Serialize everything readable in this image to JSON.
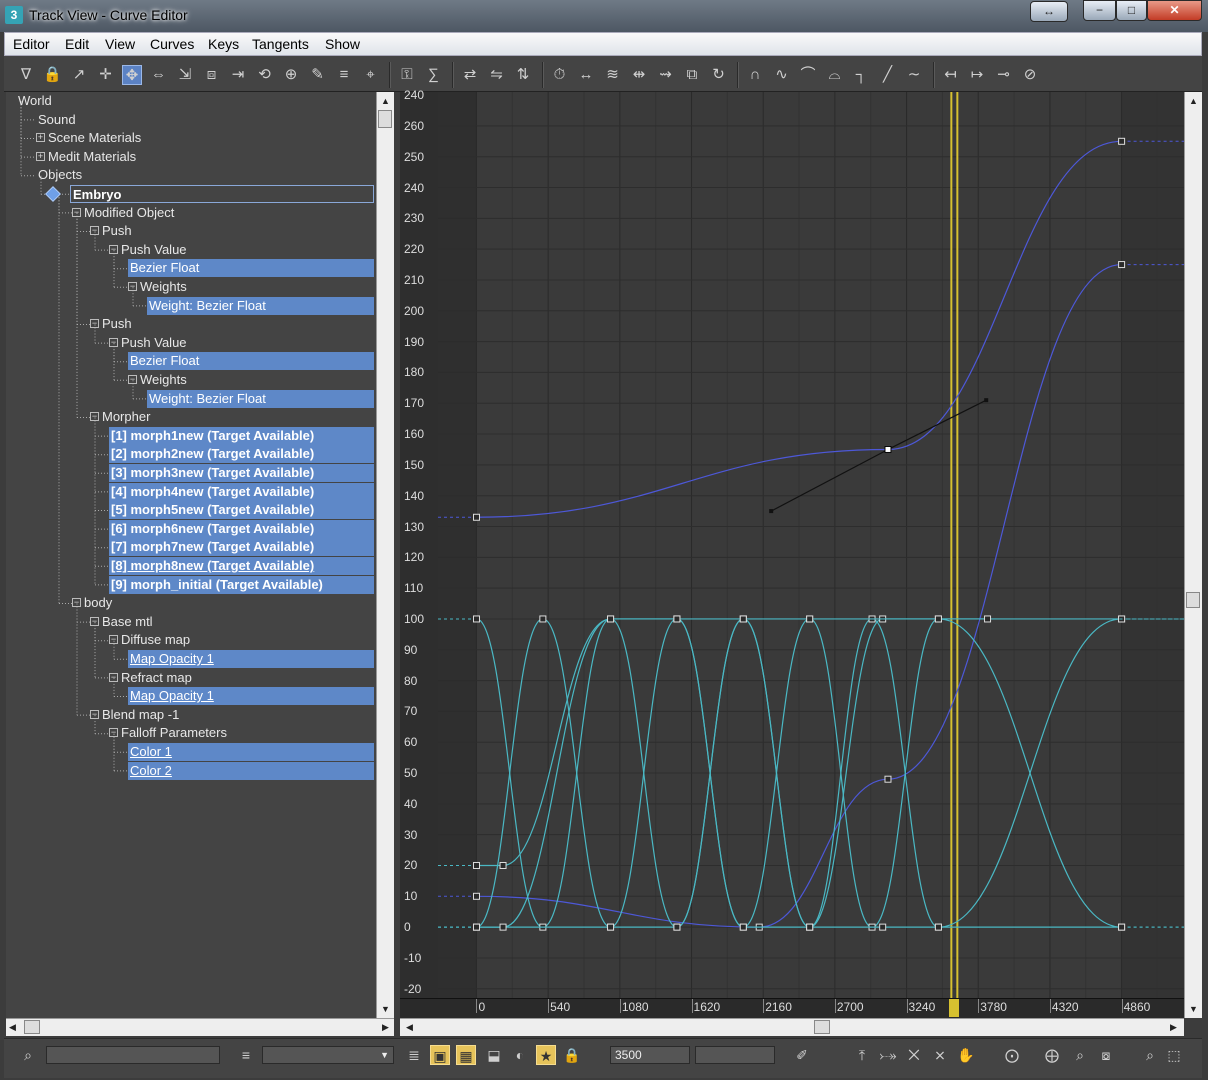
{
  "window": {
    "title": "Track View - Curve Editor",
    "app_icon": "3",
    "expand_icon": "double-arrow-icon",
    "min_glyph": "−",
    "max_glyph": "□",
    "close_glyph": "✕"
  },
  "menu": [
    "Editor",
    "Edit",
    "View",
    "Curves",
    "Keys",
    "Tangents",
    "Show"
  ],
  "toolbar_icons": [
    "filter-icon",
    "lock-icon",
    "select-icon",
    "move-keys-icon",
    "slide-keys-icon",
    "scale-keys-icon",
    "scale-values-icon",
    "region-icon",
    "retime-icon",
    "retimer-icon",
    "add-keys-icon",
    "draw-curves-icon",
    "reduce-keys-icon",
    "snap-icon",
    "lock-selection-icon",
    "key-stats-icon",
    "align-icon",
    "mirror-icon",
    "flip-icon",
    "time-icon",
    "range-icon",
    "ease-icon",
    "stretch-icon",
    "offset-icon",
    "bounds-icon",
    "loop-icon",
    "tangent-auto-icon",
    "tangent-spline-icon",
    "tangent-fast-icon",
    "tangent-slow-icon",
    "tangent-step-icon",
    "tangent-linear-icon",
    "tangent-smooth-icon",
    "curve-before-icon",
    "curve-after-icon",
    "curve-handle-icon",
    "curve-lock-icon"
  ],
  "tree": [
    {
      "label": "World",
      "depth": 0
    },
    {
      "label": "Sound",
      "depth": 1
    },
    {
      "label": "Scene Materials",
      "depth": 1,
      "expander": "⊞"
    },
    {
      "label": "Medit Materials",
      "depth": 1,
      "expander": "⊞"
    },
    {
      "label": "Objects",
      "depth": 1
    },
    {
      "label": "Embryo",
      "depth": 2
    },
    {
      "label": "Modified Object",
      "depth": 3,
      "expander": "⊟"
    },
    {
      "label": "Push",
      "depth": 4,
      "expander": "⊟"
    },
    {
      "label": "Push Value",
      "depth": 5,
      "expander": "⊟"
    },
    {
      "label": "Bezier Float",
      "depth": 6
    },
    {
      "label": "Weights",
      "depth": 6,
      "expander": "⊟"
    },
    {
      "label": "Weight: Bezier Float",
      "depth": 7
    },
    {
      "label": "Push",
      "depth": 4,
      "expander": "⊟"
    },
    {
      "label": "Push Value",
      "depth": 5,
      "expander": "⊟"
    },
    {
      "label": "Bezier Float",
      "depth": 6
    },
    {
      "label": "Weights",
      "depth": 6,
      "expander": "⊟"
    },
    {
      "label": "Weight: Bezier Float",
      "depth": 7
    },
    {
      "label": "Morpher",
      "depth": 4,
      "expander": "⊟"
    },
    {
      "label": "[1] morph1new  (Target Available)",
      "depth": 5
    },
    {
      "label": "[2] morph2new  (Target Available)",
      "depth": 5
    },
    {
      "label": "[3] morph3new  (Target Available)",
      "depth": 5
    },
    {
      "label": "[4] morph4new  (Target Available)",
      "depth": 5
    },
    {
      "label": "[5] morph5new  (Target Available)",
      "depth": 5
    },
    {
      "label": "[6] morph6new  (Target Available)",
      "depth": 5
    },
    {
      "label": "[7] morph7new  (Target Available)",
      "depth": 5
    },
    {
      "label": "[8] morph8new  (Target Available)",
      "depth": 5
    },
    {
      "label": "[9] morph_initial  (Target Available)",
      "depth": 5
    },
    {
      "label": "body",
      "depth": 3,
      "expander": "⊟"
    },
    {
      "label": "Base mtl",
      "depth": 4,
      "expander": "⊟"
    },
    {
      "label": "Diffuse map",
      "depth": 5,
      "expander": "⊟"
    },
    {
      "label": "Map Opacity 1",
      "depth": 6
    },
    {
      "label": "Refract map",
      "depth": 5,
      "expander": "⊟"
    },
    {
      "label": "Map Opacity 1",
      "depth": 6
    },
    {
      "label": "Blend map -1",
      "depth": 4,
      "expander": "⊟"
    },
    {
      "label": "Falloff Parameters",
      "depth": 5,
      "expander": "⊟"
    },
    {
      "label": "Color 1",
      "depth": 6
    },
    {
      "label": "Color 2",
      "depth": 6
    }
  ],
  "y_axis_labels": [
    "240",
    "260",
    "250",
    "240",
    "230",
    "220",
    "210",
    "200",
    "190",
    "180",
    "170",
    "160",
    "150",
    "140",
    "130",
    "120",
    "110",
    "100",
    "90",
    "80",
    "70",
    "60",
    "50",
    "40",
    "30",
    "20",
    "10",
    "0",
    "-10",
    "-20"
  ],
  "x_axis_labels": [
    "0",
    "540",
    "1080",
    "1620",
    "2160",
    "2700",
    "3240",
    "3780",
    "4320",
    "4860"
  ],
  "chart_data": {
    "type": "line",
    "xlabel": "",
    "ylabel": "",
    "xlim": [
      -290,
      5300
    ],
    "ylim": [
      -23,
      271
    ],
    "current_frame": 3600,
    "series": [
      {
        "color": "#4d58d8",
        "keys": [
          [
            0,
            133
          ],
          [
            3100,
            155
          ],
          [
            4860,
            255
          ]
        ],
        "handle": [
          [
            2220,
            135
          ],
          [
            3100,
            155
          ],
          [
            3840,
            171
          ]
        ]
      },
      {
        "color": "#4d58d8",
        "keys": [
          [
            0,
            10
          ],
          [
            2130,
            0
          ],
          [
            3100,
            48
          ],
          [
            4860,
            215
          ]
        ]
      },
      {
        "color": "#4ab8c4",
        "keys": [
          [
            0,
            100
          ],
          [
            500,
            0
          ],
          [
            1010,
            100
          ],
          [
            1510,
            0
          ],
          [
            2010,
            100
          ],
          [
            2510,
            0
          ],
          [
            2980,
            100
          ],
          [
            3480,
            0
          ],
          [
            4860,
            100
          ]
        ]
      },
      {
        "color": "#4ab8c4",
        "keys": [
          [
            0,
            0
          ],
          [
            500,
            100
          ],
          [
            1010,
            0
          ],
          [
            1510,
            100
          ],
          [
            2010,
            0
          ],
          [
            2510,
            100
          ],
          [
            2980,
            0
          ],
          [
            3480,
            100
          ],
          [
            4860,
            0
          ]
        ]
      },
      {
        "color": "#4ab8c4",
        "keys": [
          [
            0,
            20
          ],
          [
            200,
            20
          ],
          [
            1010,
            100
          ],
          [
            1510,
            100
          ],
          [
            2010,
            0
          ],
          [
            2510,
            0
          ],
          [
            3060,
            100
          ],
          [
            3480,
            100
          ],
          [
            4860,
            100
          ]
        ]
      },
      {
        "color": "#4ab8c4",
        "keys": [
          [
            0,
            0
          ],
          [
            1010,
            0
          ],
          [
            1510,
            0
          ],
          [
            2010,
            100
          ],
          [
            2510,
            0
          ],
          [
            3060,
            0
          ],
          [
            3480,
            0
          ],
          [
            4860,
            0
          ]
        ]
      },
      {
        "color": "#4ab8c4",
        "keys": [
          [
            0,
            0
          ],
          [
            200,
            0
          ],
          [
            1010,
            100
          ],
          [
            1510,
            100
          ],
          [
            2010,
            100
          ],
          [
            2510,
            100
          ],
          [
            3480,
            100
          ],
          [
            3850,
            100
          ]
        ]
      }
    ]
  },
  "status": {
    "frame_value": "3500",
    "left_icons": [
      "zoom-region-icon",
      "filter-list-icon"
    ],
    "mid_icons": [
      "list-icon",
      "highlight-icon",
      "key-mode-icon",
      "layer-icon",
      "snap-frames-icon",
      "pin-icon",
      "lock-icon"
    ],
    "right_icons": [
      "key-filter-icon",
      "frame-all-icon",
      "frame-horizontal-icon",
      "zoom-values-icon",
      "zoom-horizontal-icon",
      "pan-icon",
      "zoom-extents-icon",
      "zoom-extents-value-icon",
      "zoom-icon",
      "zoom-region2-icon"
    ]
  }
}
